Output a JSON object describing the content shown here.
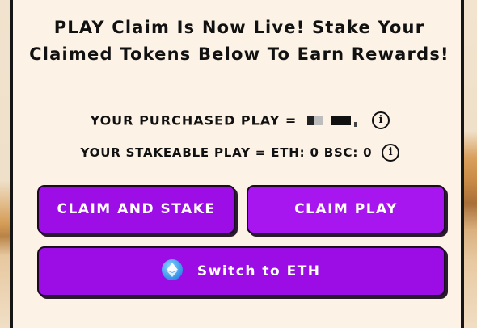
{
  "headline": "PLAY Claim Is Now Live! Stake Your Claimed Tokens Below To Earn Rewards!",
  "purchased": {
    "label": "YOUR PURCHASED PLAY =",
    "info_icon": "info-icon"
  },
  "stakeable": {
    "label": "YOUR STAKEABLE PLAY = ETH: 0 BSC: 0",
    "info_icon": "info-icon"
  },
  "buttons": {
    "claim_and_stake": "CLAIM AND STAKE",
    "claim_play": "CLAIM PLAY",
    "switch_network": "Switch to ETH",
    "switch_icon": "ethereum-icon"
  },
  "colors": {
    "button_purple": "#9d0de6",
    "panel_background": "#fcf2e6",
    "text": "#111111"
  }
}
